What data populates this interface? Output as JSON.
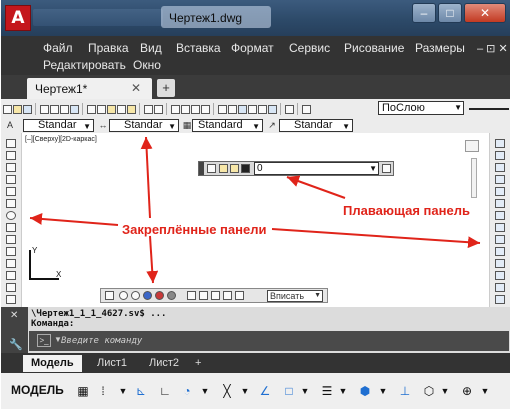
{
  "window": {
    "title": "Чертеж1.dwg",
    "app_logo": "A",
    "controls": {
      "minimize": "–",
      "maximize": "□",
      "close": "✕"
    }
  },
  "menubar": {
    "items": [
      "Файл",
      "Правка",
      "Вид",
      "Вставка",
      "Формат",
      "Сервис",
      "Рисование",
      "Размеры"
    ],
    "second_row": [
      "Редактировать",
      "Окно"
    ],
    "window_controls": "– ⊡ ✕"
  },
  "file_tabs": {
    "active_label": "Чертеж1*",
    "close": "✕",
    "new_tab": "+"
  },
  "toolbar": {
    "layer_combo": "ПоСлою",
    "text_style": "Standar",
    "dim_style": "Standar",
    "table_style": "Standard",
    "mleader_style": "Standar"
  },
  "viewport": {
    "view_label": "[–][Сверху][2D-каркас]",
    "axis_y": "Y",
    "axis_x": "X"
  },
  "floating_panel": {
    "layer_value": "0"
  },
  "annotations": {
    "floating_panel_label": "Плавающая панель",
    "docked_panels_label": "Закреплённые панели"
  },
  "bottom_panel": {
    "combo_value": "Вписать"
  },
  "command_line": {
    "line1": "\\Чертеж1_1_1_4627.sv$ ...",
    "line2": "Команда:",
    "placeholder": "Введите команду"
  },
  "layout_tabs": [
    "Модель",
    "Лист1",
    "Лист2",
    "+"
  ],
  "statusbar": {
    "model_label": "МОДЕЛЬ",
    "icons": [
      "grid-icon",
      "snap-icon",
      "ortho-icon",
      "polar-icon",
      "osnap-icon",
      "lineweight-icon",
      "transparency-icon",
      "selection-cycling-icon",
      "3d-osnap-icon",
      "ucs-icon",
      "annotation-icon",
      "workspace-icon"
    ]
  },
  "colors": {
    "title_bar": "#2d4a69",
    "menu_bg": "#333333",
    "annotation_red": "#e0241a",
    "app_logo_red": "#c4161c"
  }
}
